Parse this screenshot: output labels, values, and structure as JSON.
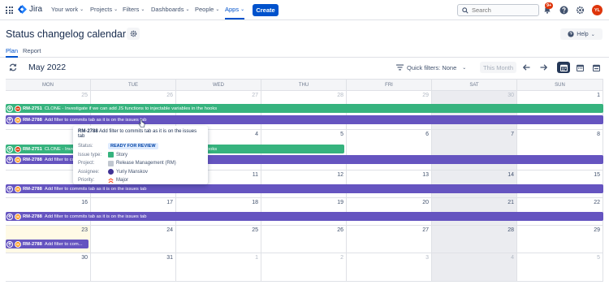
{
  "app": {
    "logo_text": "Jira"
  },
  "nav": {
    "items": [
      {
        "label": "Your work",
        "chevron": "⌄"
      },
      {
        "label": "Projects",
        "chevron": "⌄"
      },
      {
        "label": "Filters",
        "chevron": "⌄"
      },
      {
        "label": "Dashboards",
        "chevron": "⌄"
      },
      {
        "label": "People",
        "chevron": "⌄"
      },
      {
        "label": "Apps",
        "chevron": "⌄"
      }
    ],
    "create_label": "Create",
    "search_placeholder": "Search",
    "notifications_badge": "9+",
    "avatar_initials": "YL"
  },
  "page": {
    "title": "Status changelog calendar",
    "help_label": "Help",
    "tabs": [
      {
        "label": "Plan"
      },
      {
        "label": "Report"
      }
    ]
  },
  "toolbar": {
    "month_label": "May 2022",
    "quick_filters_label": "Quick filters: None",
    "this_month_label": "This Month"
  },
  "calendar": {
    "weekdays": [
      "MON",
      "TUE",
      "WED",
      "THU",
      "FRI",
      "SAT",
      "SUN"
    ],
    "weeks": [
      [
        "25",
        "26",
        "27",
        "28",
        "29",
        "30",
        "1"
      ],
      [
        "2",
        "3",
        "4",
        "5",
        "6",
        "7",
        "8"
      ],
      [
        "9",
        "10",
        "11",
        "12",
        "13",
        "14",
        "15"
      ],
      [
        "16",
        "17",
        "18",
        "19",
        "20",
        "21",
        "22"
      ],
      [
        "23",
        "24",
        "25",
        "26",
        "27",
        "28",
        "29"
      ],
      [
        "30",
        "31",
        "1",
        "2",
        "3",
        "4",
        "5"
      ]
    ],
    "events": [
      {
        "key": "RM-2751",
        "summary": "CLONE - Investigate if we can add JS functions to injectable variables in the hooks",
        "color": "#36b37e",
        "priority_icon": "minus-icon"
      },
      {
        "key": "RM-2788",
        "summary": "Add filter to commits tab as it is on the issues tab",
        "color": "#6554c0",
        "priority_icon": "equals-icon"
      },
      {
        "key": "RM-2751",
        "summary": "CLONE - Investigate if we can add JS functions to injectable variables in the hooks",
        "color": "#36b37e",
        "priority_icon": "minus-icon"
      },
      {
        "key": "RM-2788",
        "summary": "Add filter to commits tab as it is on the issues tab",
        "color": "#6554c0",
        "priority_icon": "equals-icon"
      },
      {
        "key": "RM-2788",
        "summary": "Add filter to commits tab as it is on the issues tab",
        "color": "#6554c0",
        "priority_icon": "equals-icon"
      },
      {
        "key": "RM-2788",
        "summary": "Add filter to commits tab as it is on the issues tab",
        "color": "#6554c0",
        "priority_icon": "equals-icon"
      },
      {
        "key": "RM-2788",
        "summary": "Add filter to com...",
        "color": "#6554c0",
        "priority_icon": "equals-icon"
      }
    ]
  },
  "tooltip": {
    "key": "RM-2788",
    "summary": "Add filter to commits tab as it is on the issues tab",
    "status_label": "Status:",
    "status_value": "READY FOR REVIEW",
    "issue_type_label": "Issue type:",
    "issue_type_value": "Story",
    "project_label": "Project:",
    "project_value": "Release Management (RM)",
    "assignee_label": "Assignee:",
    "assignee_value": "Yuriy Manskov",
    "priority_label": "Priority:",
    "priority_value": "Major"
  }
}
